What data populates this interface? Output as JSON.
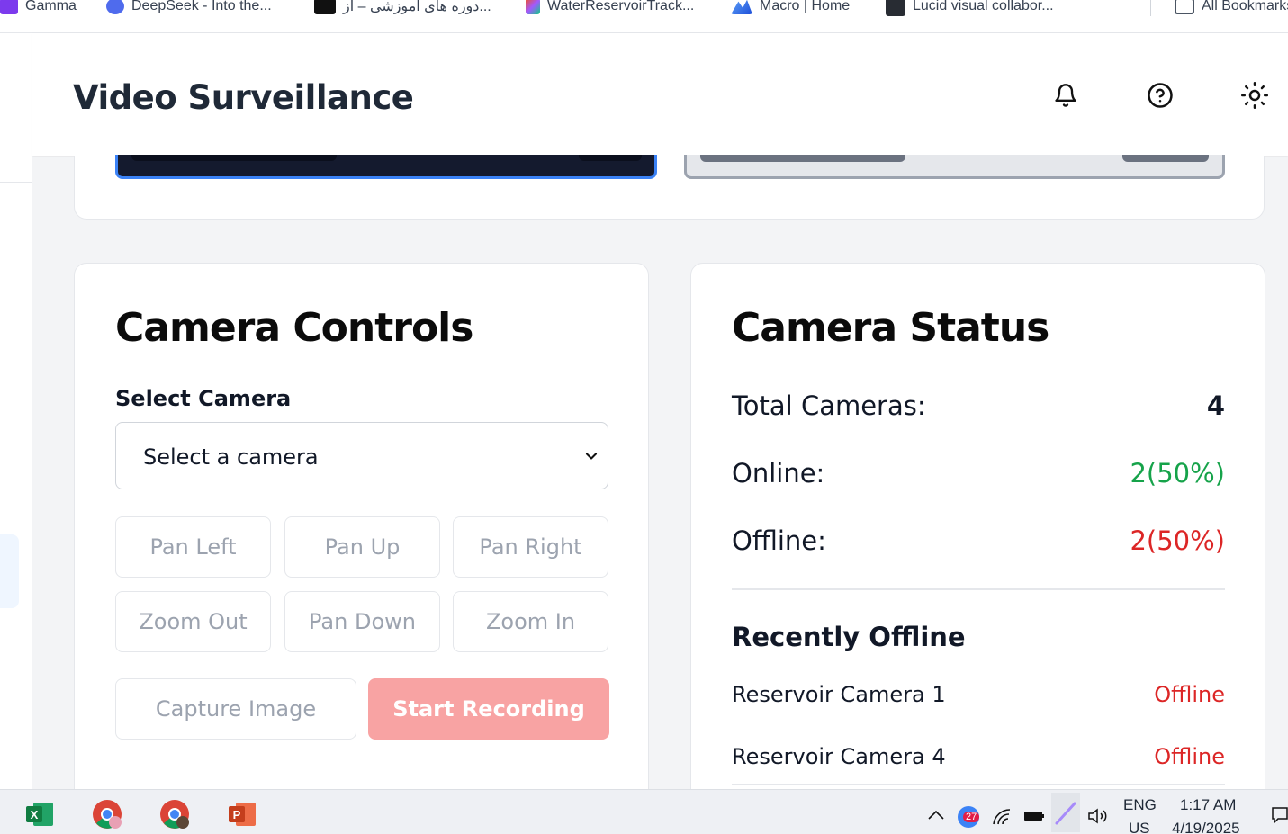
{
  "bookmarks": [
    {
      "label": "Gamma",
      "icon": "gamma-icon"
    },
    {
      "label": "DeepSeek - Into the...",
      "icon": "deepseek-icon"
    },
    {
      "label": "دوره های آموزشی – از...",
      "icon": "ielts-icon"
    },
    {
      "label": "WaterReservoirTrack...",
      "icon": "figma-icon"
    },
    {
      "label": "Macro | Home",
      "icon": "macro-icon"
    },
    {
      "label": "Lucid visual collabor...",
      "icon": "lucid-icon"
    },
    {
      "label": "All Bookmarks",
      "icon": "folder-icon"
    }
  ],
  "header": {
    "title": "Video Surveillance",
    "icons": [
      "bell-icon",
      "help-icon",
      "sun-icon"
    ]
  },
  "controls": {
    "title": "Camera Controls",
    "select_label": "Select Camera",
    "select_value": "Select a camera",
    "buttons": [
      "Pan Left",
      "Pan Up",
      "Pan Right",
      "Zoom Out",
      "Pan Down",
      "Zoom In"
    ],
    "capture": "Capture Image",
    "record": "Start Recording"
  },
  "status": {
    "title": "Camera Status",
    "total_label": "Total Cameras:",
    "total_value": "4",
    "online_label": "Online:",
    "online_value": "2(50%)",
    "offline_label": "Offline:",
    "offline_value": "2(50%)",
    "recent_title": "Recently Offline",
    "recent": [
      {
        "name": "Reservoir Camera 1",
        "state": "Offline"
      },
      {
        "name": "Reservoir Camera 4",
        "state": "Offline"
      }
    ]
  },
  "taskbar": {
    "apps": [
      "excel-icon",
      "chrome-icon",
      "chrome-profile-icon",
      "powerpoint-icon"
    ],
    "notification_count": "27",
    "lang_top": "ENG",
    "lang_bottom": "US",
    "time": "1:17 AM",
    "date": "4/19/2025"
  },
  "colors": {
    "online": "#16a34a",
    "offline": "#dc2626",
    "record_button": "#f8a3a3",
    "selected_feed_border": "#3b82f6"
  }
}
